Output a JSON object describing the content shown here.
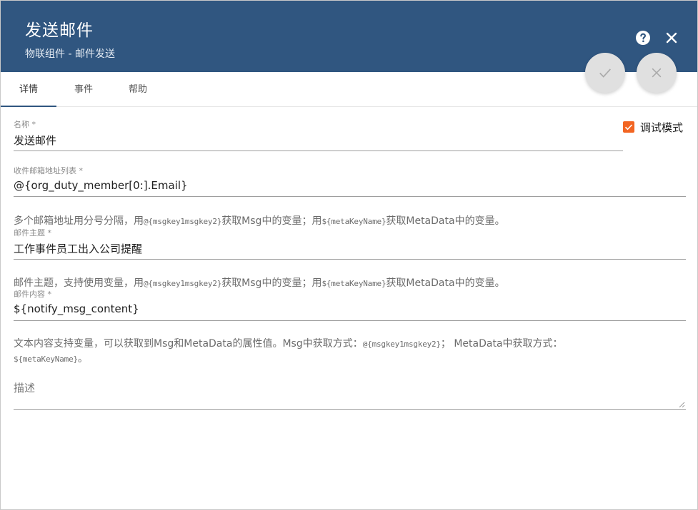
{
  "header": {
    "title": "发送邮件",
    "subtitle": "物联组件 - 邮件发送",
    "help_icon": "help-circle-icon",
    "close_icon": "close-icon"
  },
  "actions": {
    "save_icon": "check-icon",
    "cancel_icon": "close-icon"
  },
  "tabs": [
    {
      "label": "详情",
      "active": true
    },
    {
      "label": "事件",
      "active": false
    },
    {
      "label": "帮助",
      "active": false
    }
  ],
  "form": {
    "name": {
      "label": "名称 *",
      "value": "发送邮件"
    },
    "debug": {
      "label": "调试模式",
      "checked": true
    },
    "recipients": {
      "label": "收件邮箱地址列表 *",
      "value": "@{org_duty_member[0:].Email}",
      "hint_a": "多个邮箱地址用分号分隔，用",
      "hint_code1": "@{msgkey1msgkey2}",
      "hint_b": "获取Msg中的变量；用",
      "hint_code2": "${metaKeyName}",
      "hint_c": "获取MetaData中的变量。"
    },
    "subject": {
      "label": "邮件主题 *",
      "value": "工作事件员工出入公司提醒",
      "hint_a": "邮件主题，支持使用变量，用",
      "hint_code1": "@{msgkey1msgkey2}",
      "hint_b": "获取Msg中的变量；用",
      "hint_code2": "${metaKeyName}",
      "hint_c": "获取MetaData中的变量。"
    },
    "content": {
      "label": "邮件内容 *",
      "value": "${notify_msg_content}",
      "hint_a": "文本内容支持变量，可以获取到Msg和MetaData的属性值。Msg中获取方式：",
      "hint_code1": "@{msgkey1msgkey2}",
      "hint_b": "；  MetaData中获取方式：",
      "hint_code2": "${metaKeyName}",
      "hint_c": "。"
    },
    "description": {
      "placeholder": "描述",
      "value": ""
    }
  },
  "colors": {
    "header_bg": "#305680",
    "accent_checkbox": "#f26522",
    "fab_bg": "#e0e0e0"
  }
}
